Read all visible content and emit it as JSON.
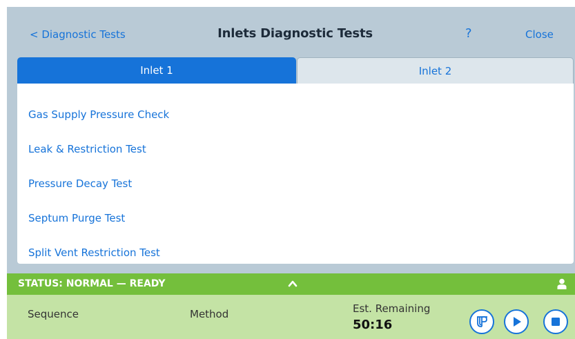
{
  "header": {
    "back_label": "< Diagnostic Tests",
    "title": "Inlets Diagnostic Tests",
    "help_label": "?",
    "close_label": "Close"
  },
  "tabs": [
    {
      "label": "Inlet 1",
      "active": true
    },
    {
      "label": "Inlet 2",
      "active": false
    }
  ],
  "tests": [
    {
      "label": "Gas Supply Pressure Check"
    },
    {
      "label": "Leak & Restriction Test"
    },
    {
      "label": "Pressure Decay Test"
    },
    {
      "label": "Septum Purge Test"
    },
    {
      "label": "Split Vent Restriction Test"
    }
  ],
  "status": {
    "text": "STATUS: NORMAL — READY",
    "expand_icon": "chevron-up-icon",
    "user_icon": "user-icon"
  },
  "info": {
    "sequence_label": "Sequence",
    "method_label": "Method",
    "remaining_label": "Est. Remaining",
    "remaining_value": "50:16"
  },
  "controls": {
    "prep_run_icon": "prep-run-icon",
    "play_icon": "play-icon",
    "stop_icon": "stop-icon"
  },
  "colors": {
    "accent": "#1673d9",
    "background": "#b9cad6",
    "status_green": "#74bf3c",
    "info_green": "#c4e3a5"
  }
}
